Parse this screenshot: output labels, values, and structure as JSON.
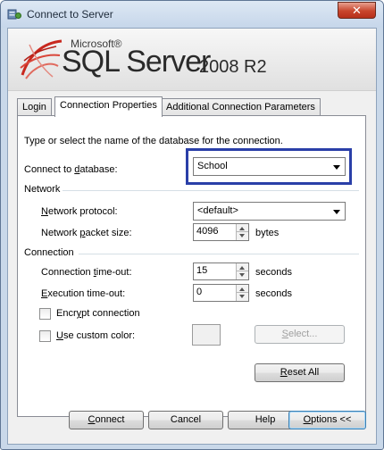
{
  "window": {
    "title": "Connect to Server",
    "close": "✕"
  },
  "banner": {
    "microsoft": "Microsoft®",
    "product": "SQL Server",
    "version": "2008 R2"
  },
  "tabs": [
    {
      "label": "Login",
      "active": false
    },
    {
      "label": "Connection Properties",
      "active": true
    },
    {
      "label": "Additional Connection Parameters",
      "active": false
    }
  ],
  "panel": {
    "instruction": "Type or select the name of the database for the connection.",
    "database": {
      "label_pre": "Connect to ",
      "label_u": "d",
      "label_post": "atabase:",
      "value": "School"
    },
    "network_group": "Network",
    "protocol": {
      "label_pre": "",
      "label_u": "N",
      "label_post": "etwork protocol:",
      "value": "<default>"
    },
    "packet": {
      "label_pre": "Network ",
      "label_u": "p",
      "label_post": "acket size:",
      "value": "4096",
      "unit": "bytes"
    },
    "connection_group": "Connection",
    "conn_timeout": {
      "label_pre": "Connection ",
      "label_u": "t",
      "label_post": "ime-out:",
      "value": "15",
      "unit": "seconds"
    },
    "exec_timeout": {
      "label_pre": "",
      "label_u": "E",
      "label_post": "xecution time-out:",
      "value": "0",
      "unit": "seconds"
    },
    "encrypt": {
      "label_pre": "Encr",
      "label_u": "y",
      "label_post": "pt connection",
      "checked": false
    },
    "custom_color": {
      "label_pre": "",
      "label_u": "U",
      "label_post": "se custom color:",
      "checked": false
    },
    "select_btn": {
      "label_pre": "",
      "label_u": "S",
      "label_post": "elect..."
    },
    "reset_btn": {
      "label_pre": "",
      "label_u": "R",
      "label_post": "eset All"
    }
  },
  "footer": {
    "connect": {
      "label_pre": "",
      "label_u": "C",
      "label_post": "onnect"
    },
    "cancel": "Cancel",
    "help": "Help",
    "options": {
      "label_pre": "",
      "label_u": "O",
      "label_post": "ptions <<"
    }
  },
  "colors": {
    "highlight": "#2a3fa8",
    "logo_red": "#c8281e"
  }
}
